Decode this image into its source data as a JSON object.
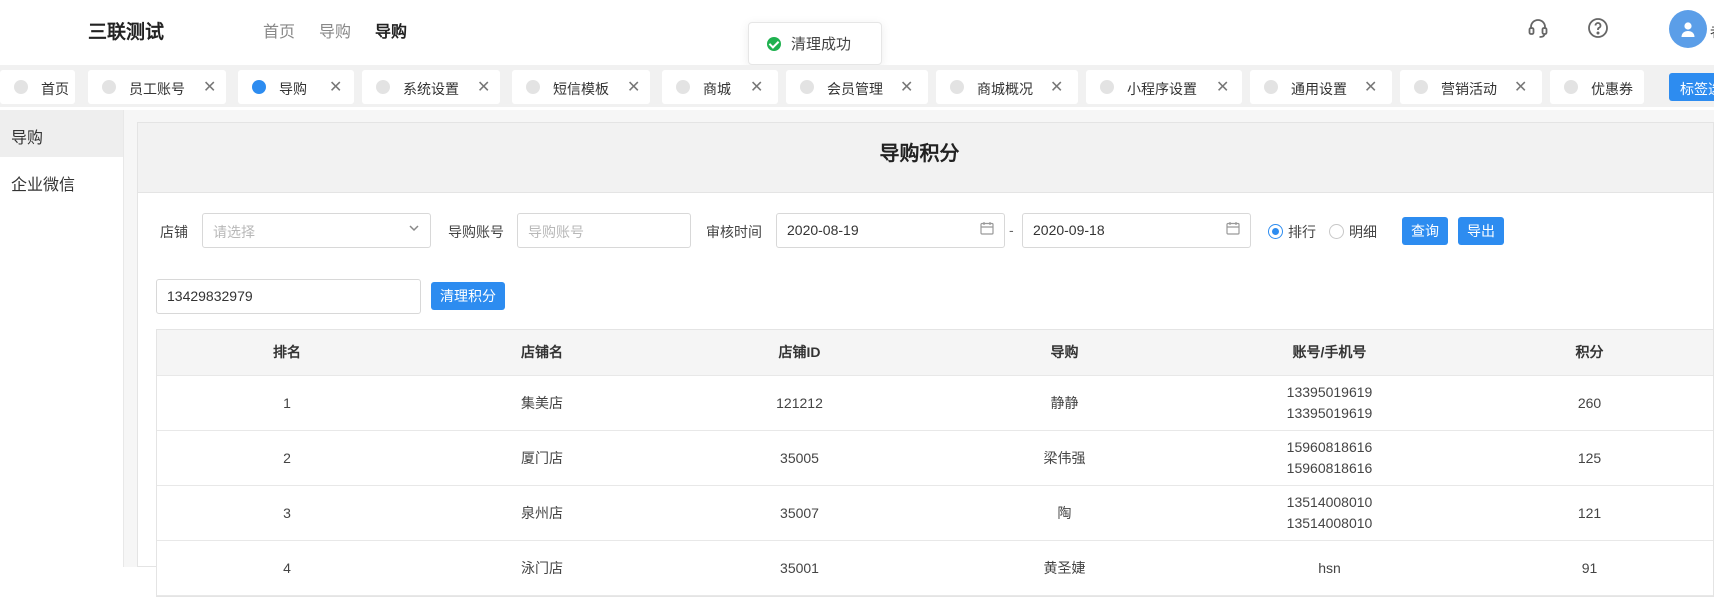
{
  "header": {
    "brand": "三联测试",
    "nav": [
      "首页",
      "导购",
      "导购"
    ],
    "avatar_partial_text": "者"
  },
  "toast": {
    "message": "清理成功"
  },
  "tabs": [
    {
      "label": "首页",
      "closable": false,
      "active": false
    },
    {
      "label": "员工账号",
      "closable": true,
      "active": false
    },
    {
      "label": "导购",
      "closable": true,
      "active": true
    },
    {
      "label": "系统设置",
      "closable": true,
      "active": false
    },
    {
      "label": "短信模板",
      "closable": true,
      "active": false
    },
    {
      "label": "商城",
      "closable": true,
      "active": false
    },
    {
      "label": "会员管理",
      "closable": true,
      "active": false
    },
    {
      "label": "商城概况",
      "closable": true,
      "active": false
    },
    {
      "label": "小程序设置",
      "closable": true,
      "active": false
    },
    {
      "label": "通用设置",
      "closable": true,
      "active": false
    },
    {
      "label": "营销活动",
      "closable": true,
      "active": false
    },
    {
      "label": "优惠券",
      "closable": false,
      "active": false
    }
  ],
  "tab_options_button": "标签选项",
  "sidebar": {
    "items": [
      "导购",
      "企业微信"
    ]
  },
  "page": {
    "title": "导购积分",
    "filters": {
      "store_label": "店铺",
      "store_placeholder": "请选择",
      "account_label": "导购账号",
      "account_placeholder": "导购账号",
      "time_label": "审核时间",
      "date_from": "2020-08-19",
      "date_sep": "-",
      "date_to": "2020-09-18",
      "radio_rank": "排行",
      "radio_detail": "明细",
      "radio_selected": "排行",
      "query_button": "查询",
      "export_button": "导出",
      "clear_input_value": "13429832979",
      "clear_button": "清理积分"
    },
    "table": {
      "columns": [
        "排名",
        "店铺名",
        "店铺ID",
        "导购",
        "账号/手机号",
        "积分"
      ],
      "rows": [
        {
          "rank": "1",
          "store": "集美店",
          "store_id": "121212",
          "guide": "静静",
          "account": [
            "13395019619",
            "13395019619"
          ],
          "points": "260"
        },
        {
          "rank": "2",
          "store": "厦门店",
          "store_id": "35005",
          "guide": "梁伟强",
          "account": [
            "15960818616",
            "15960818616"
          ],
          "points": "125"
        },
        {
          "rank": "3",
          "store": "泉州店",
          "store_id": "35007",
          "guide": "陶",
          "account": [
            "13514008010",
            "13514008010"
          ],
          "points": "121"
        },
        {
          "rank": "4",
          "store": "泳门店",
          "store_id": "35001",
          "guide": "黄圣婕",
          "account": [
            "hsn",
            ""
          ],
          "points": "91"
        }
      ]
    }
  },
  "colors": {
    "primary": "#2d8cf0",
    "success": "#1fb14f"
  }
}
